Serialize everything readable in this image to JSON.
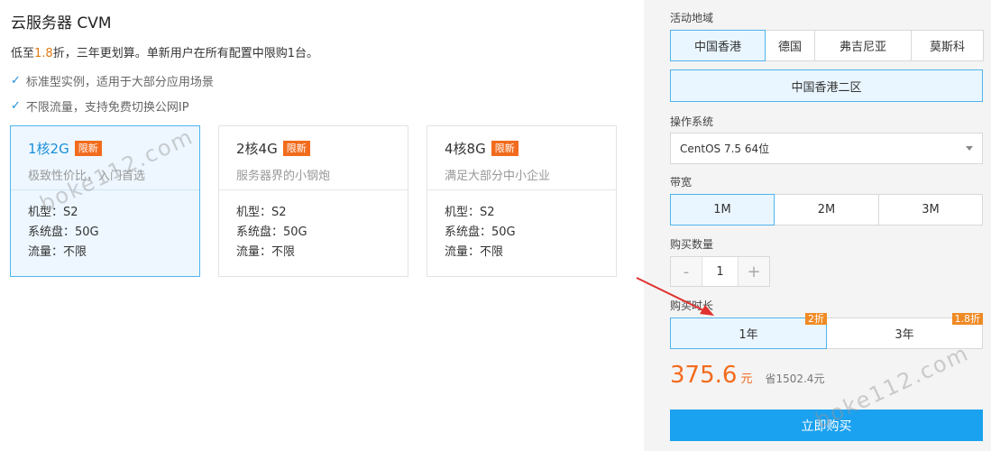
{
  "header": {
    "title": "云服务器 CVM",
    "subtitle_pre": "低至",
    "subtitle_hl": "1.8",
    "subtitle_post": "折，三年更划算。单新用户在所有配置中限购1台。",
    "features": [
      "标准型实例，适用于大部分应用场景",
      "不限流量，支持免费切换公网IP"
    ]
  },
  "cards": [
    {
      "name": "1核2G",
      "badge": "限新",
      "desc": "极致性价比，入门首选",
      "specs": [
        "机型：S2",
        "系统盘：50G",
        "流量：不限"
      ],
      "selected": true
    },
    {
      "name": "2核4G",
      "badge": "限新",
      "desc": "服务器界的小钢炮",
      "specs": [
        "机型：S2",
        "系统盘：50G",
        "流量：不限"
      ],
      "selected": false
    },
    {
      "name": "4核8G",
      "badge": "限新",
      "desc": "满足大部分中小企业",
      "specs": [
        "机型：S2",
        "系统盘：50G",
        "流量：不限"
      ],
      "selected": false
    }
  ],
  "region": {
    "label": "活动地域",
    "options": [
      "中国香港",
      "德国",
      "弗吉尼亚",
      "莫斯科"
    ],
    "selected": "中国香港",
    "zone": "中国香港二区"
  },
  "os": {
    "label": "操作系统",
    "value": "CentOS 7.5 64位"
  },
  "bandwidth": {
    "label": "带宽",
    "options": [
      "1M",
      "2M",
      "3M"
    ],
    "selected": "1M"
  },
  "quantity": {
    "label": "购买数量",
    "minus": "-",
    "value": "1",
    "plus": "+"
  },
  "duration": {
    "label": "购买时长",
    "options": [
      {
        "label": "1年",
        "tag": "2折"
      },
      {
        "label": "3年",
        "tag": "1.8折"
      }
    ],
    "selected": "1年"
  },
  "price": {
    "amount": "375.6",
    "unit": "元",
    "saving": "省1502.4元"
  },
  "buy_label": "立即购买",
  "watermark": "boke112.com",
  "colors": {
    "accent": "#1aa1f0",
    "orange": "#f26b1d",
    "select_border": "#4fb4ee",
    "select_bg": "#eaf6ff"
  }
}
